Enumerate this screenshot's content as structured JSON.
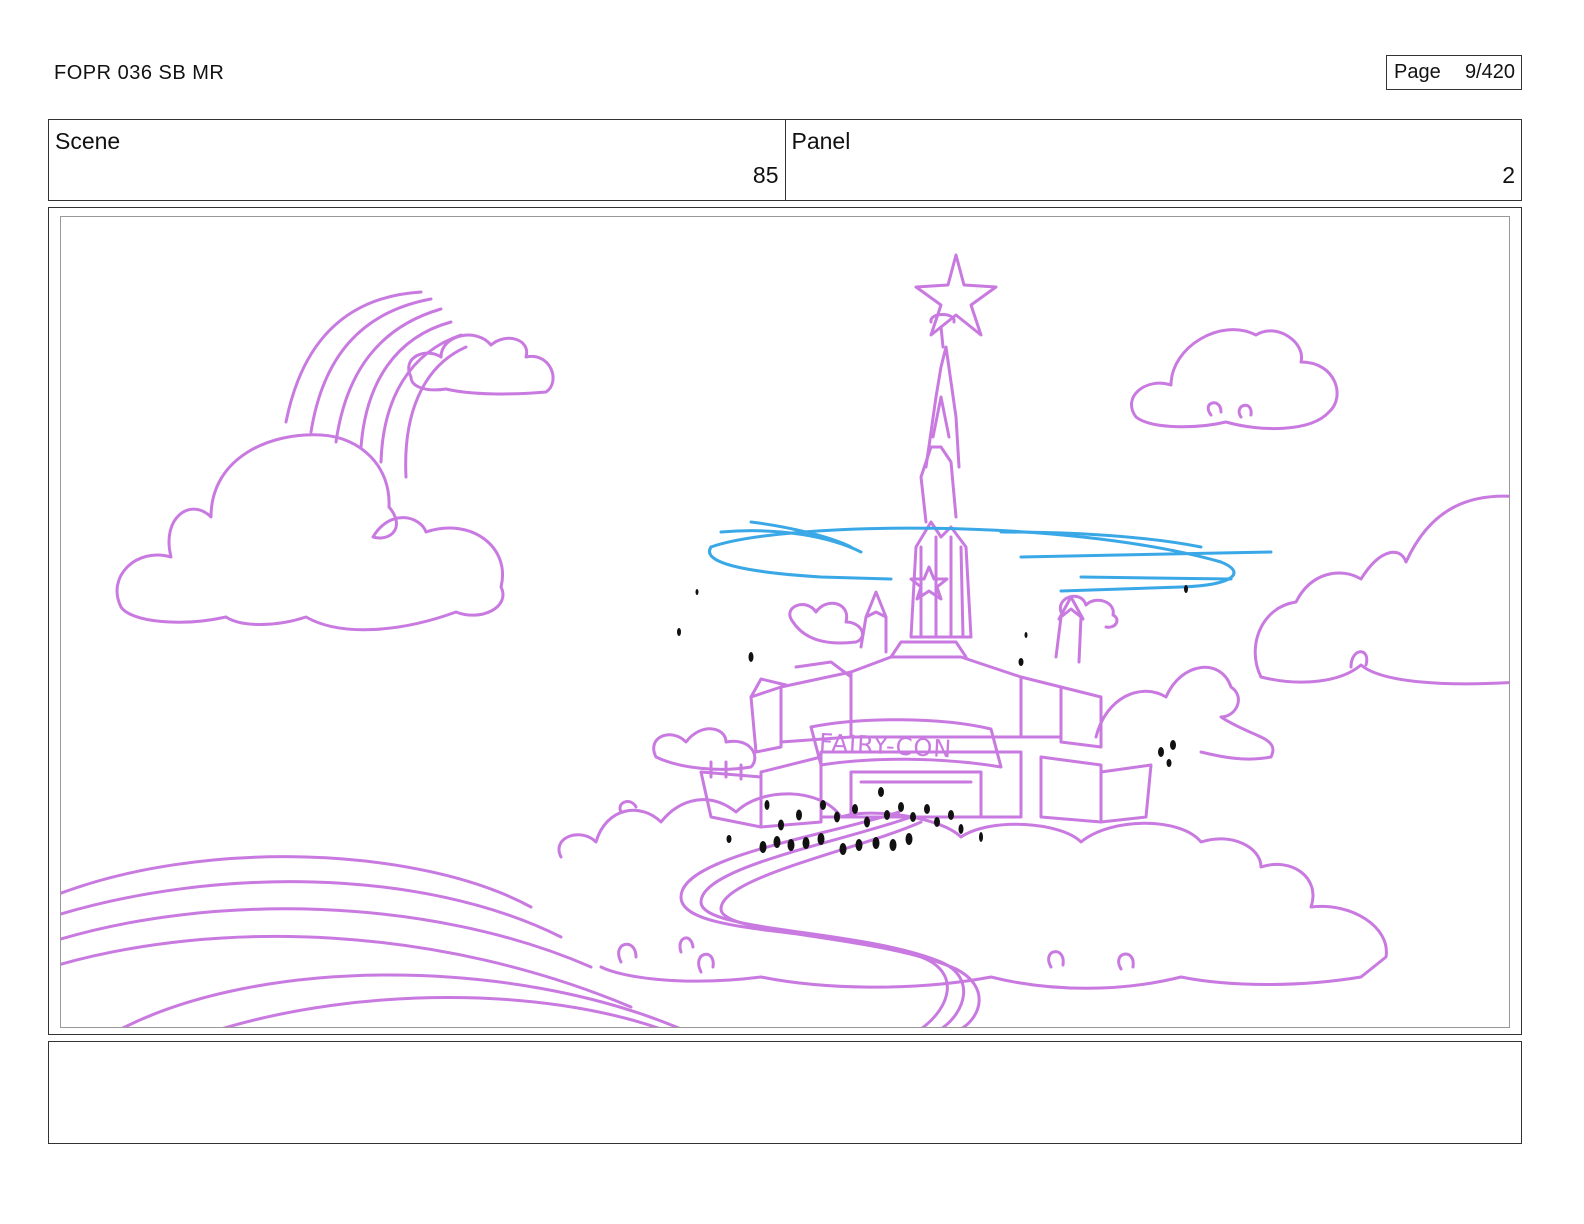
{
  "header": {
    "doc_title": "FOPR 036 SB MR",
    "page_label": "Page",
    "page_value": "9/420"
  },
  "meta": {
    "scene_label": "Scene",
    "scene_value": "85",
    "panel_label": "Panel",
    "panel_value": "2"
  },
  "drawing": {
    "banner_text": "FAIRY-CON",
    "colors": {
      "sketch": "#c97ae0",
      "ring": "#3aa8e6",
      "crowd": "#111111"
    }
  },
  "notes": {
    "text": ""
  }
}
